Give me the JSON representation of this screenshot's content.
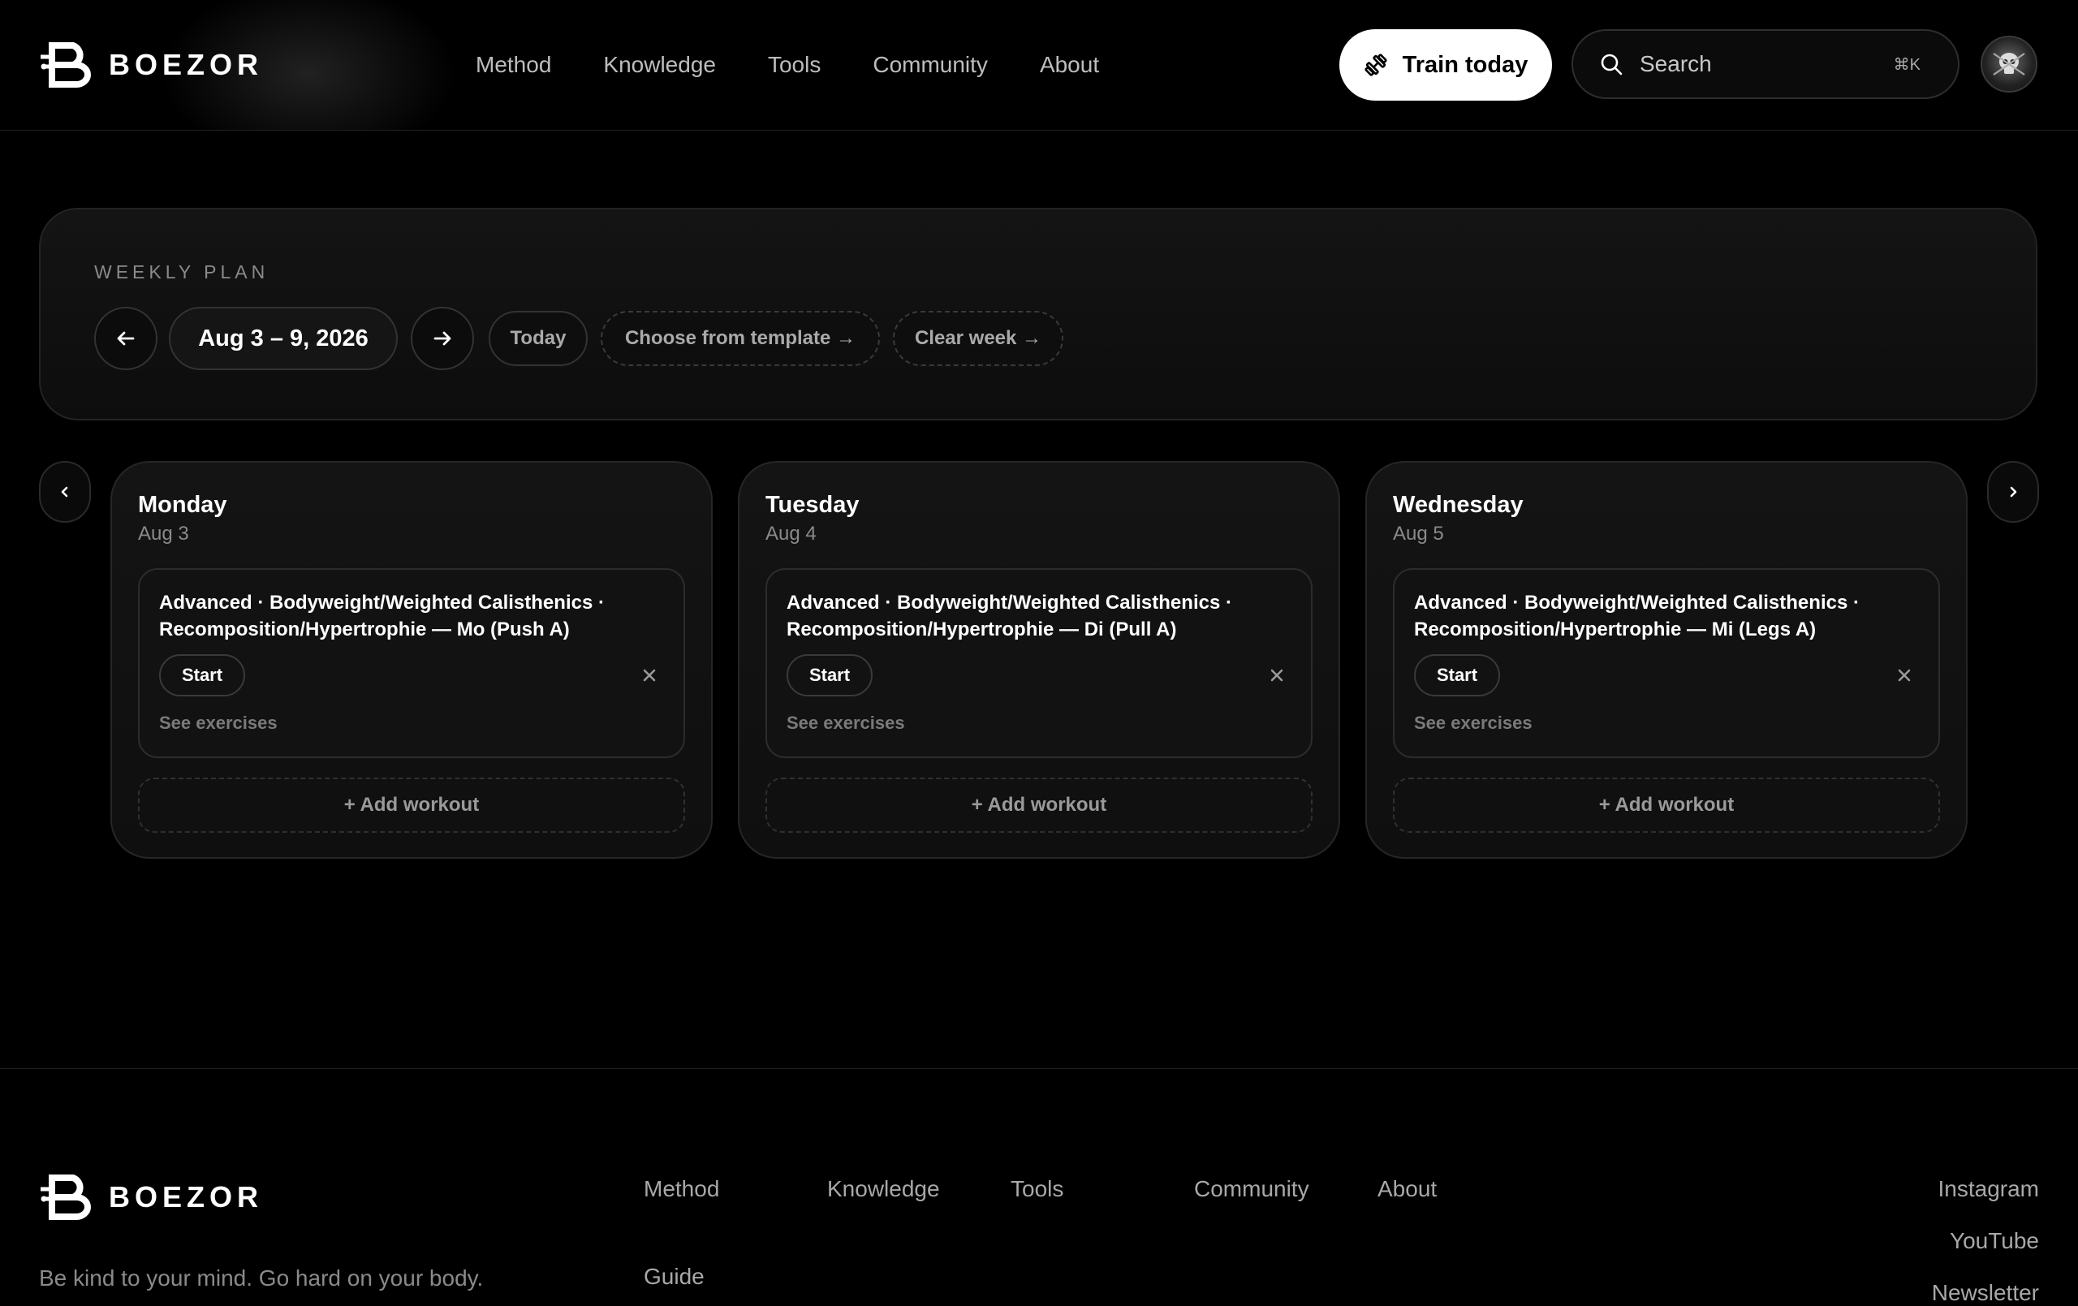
{
  "brand": {
    "name": "BOEZOR",
    "logo_icon": "b-logo-icon"
  },
  "nav": {
    "items": [
      {
        "label": "Method"
      },
      {
        "label": "Knowledge"
      },
      {
        "label": "Tools"
      },
      {
        "label": "Community"
      },
      {
        "label": "About"
      }
    ]
  },
  "header": {
    "train_label": "Train today",
    "train_icon": "dumbbell-icon",
    "search_placeholder": "Search",
    "search_shortcut": "⌘K"
  },
  "plan": {
    "label": "WEEKLY PLAN",
    "date_range": "Aug 3 – 9, 2026",
    "today_label": "Today",
    "template_label": "Choose from template →",
    "clear_label": "Clear week →"
  },
  "days": [
    {
      "name": "Monday",
      "date": "Aug 3",
      "workout": "Advanced · Bodyweight/Weighted Calisthenics · Recomposition/Hypertrophie — Mo (Push A)",
      "start_label": "Start",
      "see_label": "See exercises",
      "add_label": "+ Add workout"
    },
    {
      "name": "Tuesday",
      "date": "Aug 4",
      "workout": "Advanced · Bodyweight/Weighted Calisthenics · Recomposition/Hypertrophie — Di (Pull A)",
      "start_label": "Start",
      "see_label": "See exercises",
      "add_label": "+ Add workout"
    },
    {
      "name": "Wednesday",
      "date": "Aug 5",
      "workout": "Advanced · Bodyweight/Weighted Calisthenics · Recomposition/Hypertrophie — Mi (Legs A)",
      "start_label": "Start",
      "see_label": "See exercises",
      "add_label": "+ Add workout"
    }
  ],
  "footer": {
    "tagline": "Be kind to your mind. Go hard on your body.",
    "links": {
      "method": "Method",
      "knowledge": "Knowledge",
      "tools": "Tools",
      "community": "Community",
      "about": "About",
      "guide": "Guide"
    },
    "social": {
      "instagram": "Instagram",
      "youtube": "YouTube",
      "newsletter": "Newsletter"
    }
  },
  "colors": {
    "background": "#000000",
    "accent": "#ffffff",
    "muted": "#8a8a8a"
  }
}
